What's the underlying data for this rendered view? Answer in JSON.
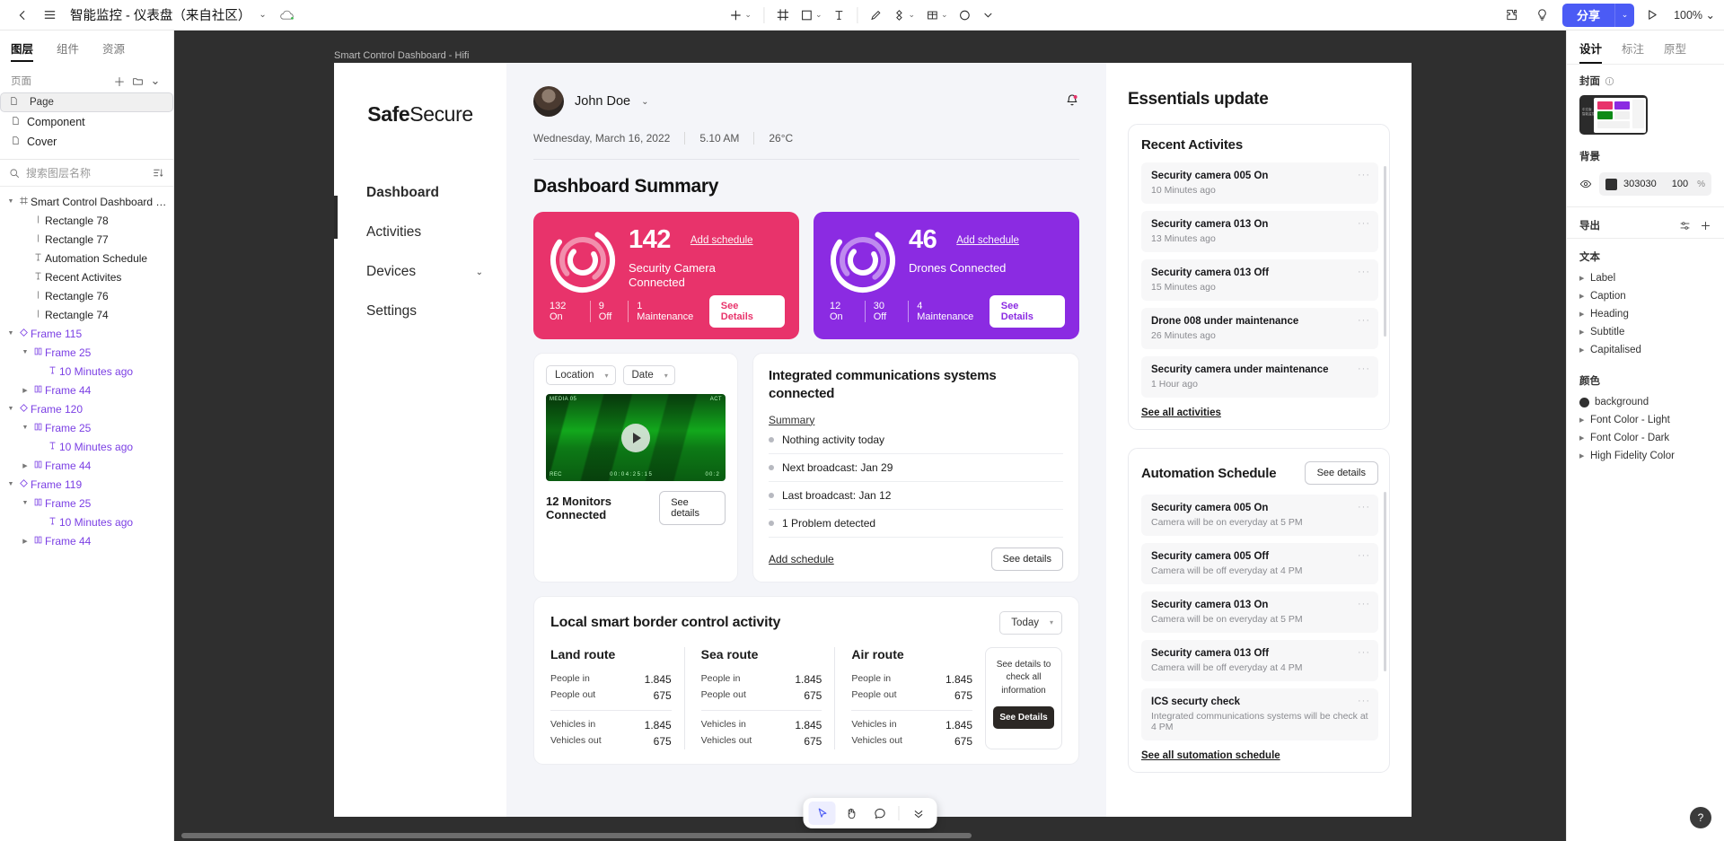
{
  "topbar": {
    "back_icon": "chevron-left-icon",
    "menu_icon": "hamburger-menu-icon",
    "doc_title": "智能监控 - 仪表盘（来自社区）",
    "title_chevron": "chevron-down-icon",
    "cloud_icon": "cloud-sync-icon",
    "tools": [
      {
        "name": "move-tool",
        "glyph": "+",
        "caret": true
      },
      {
        "name": "frame-tool",
        "glyph": "#",
        "caret": false
      },
      {
        "name": "shape-tool",
        "glyph": "□",
        "caret": true
      },
      {
        "name": "text-tool",
        "glyph": "T",
        "caret": false
      },
      {
        "name": "pen-tool",
        "glyph": "✒",
        "caret": false
      },
      {
        "name": "component-tool",
        "glyph": "◈",
        "caret": true
      },
      {
        "name": "table-tool",
        "glyph": "▤",
        "caret": true
      },
      {
        "name": "comment-tool",
        "glyph": "○",
        "caret": false
      },
      {
        "name": "more-tool",
        "glyph": "⌄",
        "caret": false
      }
    ],
    "plugin_icon": "plugin-icon",
    "idea_icon": "lightbulb-icon",
    "share_label": "分享",
    "share_caret": "chevron-down-icon",
    "present_icon": "play-icon",
    "zoom_label": "100%",
    "zoom_caret": "chevron-down-icon",
    "accent": "#4B5BF5"
  },
  "left_panel": {
    "tabs": [
      {
        "label": "图层",
        "active": true
      },
      {
        "label": "组件",
        "active": false
      },
      {
        "label": "资源",
        "active": false
      }
    ],
    "pages_label": "页面",
    "pages_add_icon": "plus-icon",
    "pages_folder_icon": "folder-icon",
    "pages_collapse_icon": "chevron-down-icon",
    "pages": [
      {
        "label": "Page",
        "selected": true
      },
      {
        "label": "Component",
        "selected": false
      },
      {
        "label": "Cover",
        "selected": false
      }
    ],
    "search_placeholder": "搜索图层名称",
    "search_icon": "search-icon",
    "filter_icon": "filter-list-icon",
    "layers": [
      {
        "label": "Smart Control Dashboard - W...",
        "depth": 0,
        "arrow": "down",
        "icon": "frame-icon",
        "purple": false
      },
      {
        "label": "Rectangle 78",
        "depth": 1,
        "arrow": "",
        "icon": "rect-icon",
        "purple": false
      },
      {
        "label": "Rectangle 77",
        "depth": 1,
        "arrow": "",
        "icon": "rect-icon",
        "purple": false
      },
      {
        "label": "Automation Schedule",
        "depth": 1,
        "arrow": "",
        "icon": "text-icon",
        "purple": false
      },
      {
        "label": "Recent Activites",
        "depth": 1,
        "arrow": "",
        "icon": "text-icon",
        "purple": false
      },
      {
        "label": "Rectangle 76",
        "depth": 1,
        "arrow": "",
        "icon": "rect-icon",
        "purple": false
      },
      {
        "label": "Rectangle 74",
        "depth": 1,
        "arrow": "",
        "icon": "rect-icon",
        "purple": false
      },
      {
        "label": "Frame 115",
        "depth": 0,
        "arrow": "down",
        "icon": "component-icon",
        "purple": true
      },
      {
        "label": "Frame 25",
        "depth": 1,
        "arrow": "down",
        "icon": "instance-icon",
        "purple": true
      },
      {
        "label": "10 Minutes ago",
        "depth": 2,
        "arrow": "",
        "icon": "text-icon",
        "purple": true
      },
      {
        "label": "Frame 44",
        "depth": 1,
        "arrow": "right",
        "icon": "instance-icon",
        "purple": true
      },
      {
        "label": "Frame 120",
        "depth": 0,
        "arrow": "down",
        "icon": "component-icon",
        "purple": true
      },
      {
        "label": "Frame 25",
        "depth": 1,
        "arrow": "down",
        "icon": "instance-icon",
        "purple": true
      },
      {
        "label": "10 Minutes ago",
        "depth": 2,
        "arrow": "",
        "icon": "text-icon",
        "purple": true
      },
      {
        "label": "Frame 44",
        "depth": 1,
        "arrow": "right",
        "icon": "instance-icon",
        "purple": true
      },
      {
        "label": "Frame 119",
        "depth": 0,
        "arrow": "down",
        "icon": "component-icon",
        "purple": true
      },
      {
        "label": "Frame 25",
        "depth": 1,
        "arrow": "down",
        "icon": "instance-icon",
        "purple": true
      },
      {
        "label": "10 Minutes ago",
        "depth": 2,
        "arrow": "",
        "icon": "text-icon",
        "purple": true
      },
      {
        "label": "Frame 44",
        "depth": 1,
        "arrow": "right",
        "icon": "instance-icon",
        "purple": true
      }
    ]
  },
  "canvas": {
    "frame_label": "Smart Control Dashboard - Hifi",
    "background": "#2f2f2f"
  },
  "floatbar": {
    "tools": [
      {
        "name": "cursor-tool",
        "glyph": "➤",
        "active": true
      },
      {
        "name": "hand-tool",
        "glyph": "✋",
        "active": false
      },
      {
        "name": "comment-tool",
        "glyph": "💬",
        "active": false
      },
      {
        "name": "more-tool",
        "glyph": "⌄",
        "active": false
      }
    ]
  },
  "app": {
    "brand_bold": "Safe",
    "brand_light": "Secure",
    "nav": [
      {
        "label": "Dashboard",
        "active": true,
        "chevron": false
      },
      {
        "label": "Activities",
        "active": false,
        "chevron": false
      },
      {
        "label": "Devices",
        "active": false,
        "chevron": true
      },
      {
        "label": "Settings",
        "active": false,
        "chevron": false
      }
    ],
    "user_name": "John Doe",
    "user_caret": "chevron-down-icon",
    "bell_icon": "notification-bell-icon",
    "meta": [
      "Wednesday, March 16, 2022",
      "5.10 AM",
      "26°C"
    ],
    "summary_title": "Dashboard Summary",
    "stats": [
      {
        "value": "142",
        "label": "Security Camera Connected",
        "add_schedule": "Add schedule",
        "breakdown": [
          "132 On",
          "9 Off",
          "1 Maintenance"
        ],
        "button": "See Details",
        "color": "#E8336B",
        "btn_text_color": "#E8336B"
      },
      {
        "value": "46",
        "label": "Drones Connected",
        "add_schedule": "Add schedule",
        "breakdown": [
          "12 On",
          "30 Off",
          "4 Maintenance"
        ],
        "button": "See Details",
        "color": "#8B2BE2",
        "btn_text_color": "#8B2BE2"
      }
    ],
    "video_card": {
      "filters": [
        {
          "label": "Location",
          "caret": "chevron-down-icon"
        },
        {
          "label": "Date",
          "caret": "chevron-down-icon"
        }
      ],
      "overlay_left": "MEDIA 05",
      "overlay_right": "ACT",
      "overlay_rec": "REC",
      "timecode": "00:04:25:15",
      "timecode_right": "00:2",
      "play_icon": "play-icon",
      "footer_label": "12 Monitors Connected",
      "footer_button": "See details"
    },
    "comms_card": {
      "title": "Integrated communications systems connected",
      "summary_label": "Summary",
      "items": [
        "Nothing activity today",
        "Next broadcast: Jan 29",
        "Last broadcast: Jan 12",
        "1 Problem detected"
      ],
      "add_schedule": "Add schedule",
      "button": "See details"
    },
    "border_card": {
      "title": "Local smart border control activity",
      "period": "Today",
      "period_caret": "chevron-down-icon",
      "routes": [
        {
          "name": "Land route",
          "rows_top": [
            {
              "k": "People in",
              "v": "1.845"
            },
            {
              "k": "People out",
              "v": "675"
            }
          ],
          "rows_bottom": [
            {
              "k": "Vehicles in",
              "v": "1.845"
            },
            {
              "k": "Vehicles out",
              "v": "675"
            }
          ]
        },
        {
          "name": "Sea route",
          "rows_top": [
            {
              "k": "People in",
              "v": "1.845"
            },
            {
              "k": "People out",
              "v": "675"
            }
          ],
          "rows_bottom": [
            {
              "k": "Vehicles in",
              "v": "1.845"
            },
            {
              "k": "Vehicles out",
              "v": "675"
            }
          ]
        },
        {
          "name": "Air route",
          "rows_top": [
            {
              "k": "People in",
              "v": "1.845"
            },
            {
              "k": "People out",
              "v": "675"
            }
          ],
          "rows_bottom": [
            {
              "k": "Vehicles in",
              "v": "1.845"
            },
            {
              "k": "Vehicles out",
              "v": "675"
            }
          ]
        }
      ],
      "see_box_text": "See details to check all information",
      "see_box_button": "See Details"
    },
    "essentials_title": "Essentials update",
    "recent": {
      "title": "Recent Activites",
      "items": [
        {
          "name": "Security camera 005 On",
          "sub": "10 Minutes ago"
        },
        {
          "name": "Security camera 013 On",
          "sub": "13 Minutes ago"
        },
        {
          "name": "Security camera 013 Off",
          "sub": "15 Minutes ago"
        },
        {
          "name": "Drone 008 under maintenance",
          "sub": "26 Minutes ago"
        },
        {
          "name": "Security camera under maintenance",
          "sub": "1 Hour ago"
        }
      ],
      "see_all": "See all activities"
    },
    "automation": {
      "title": "Automation Schedule",
      "button": "See details",
      "items": [
        {
          "name": "Security camera 005 On",
          "sub": "Camera will be on everyday at 5 PM"
        },
        {
          "name": "Security camera 005 Off",
          "sub": "Camera will be off everyday at 4 PM"
        },
        {
          "name": "Security camera 013 On",
          "sub": "Camera will be on everyday at 5 PM"
        },
        {
          "name": "Security camera 013 Off",
          "sub": "Camera will be off everyday at 4 PM"
        },
        {
          "name": "ICS securty check",
          "sub": "Integrated communications systems will be check at 4 PM"
        }
      ],
      "see_all": "See all sutomation schedule"
    }
  },
  "right_panel": {
    "tabs": [
      {
        "label": "设计",
        "active": true
      },
      {
        "label": "标注",
        "active": false
      },
      {
        "label": "原型",
        "active": false
      }
    ],
    "cover_label": "封面",
    "cover_info_icon": "info-icon",
    "cover_thumb_text": "中文版\n智能监控",
    "background_label": "背景",
    "bg_eye_icon": "eye-icon",
    "bg_hex": "303030",
    "bg_opacity": "100",
    "bg_opacity_unit": "%",
    "export_label": "导出",
    "export_settings_icon": "sliders-icon",
    "export_add_icon": "plus-icon",
    "text_label": "文本",
    "text_styles": [
      "Label",
      "Caption",
      "Heading",
      "Subtitle",
      "Capitalised"
    ],
    "color_label": "颜色",
    "color_styles": [
      {
        "label": "background",
        "swatch": true,
        "color": "#303030"
      },
      {
        "label": "Font Color - Light",
        "swatch": false
      },
      {
        "label": "Font Color - Dark",
        "swatch": false
      },
      {
        "label": "High Fidelity Color",
        "swatch": false
      }
    ],
    "help_icon": "question-mark-icon"
  }
}
